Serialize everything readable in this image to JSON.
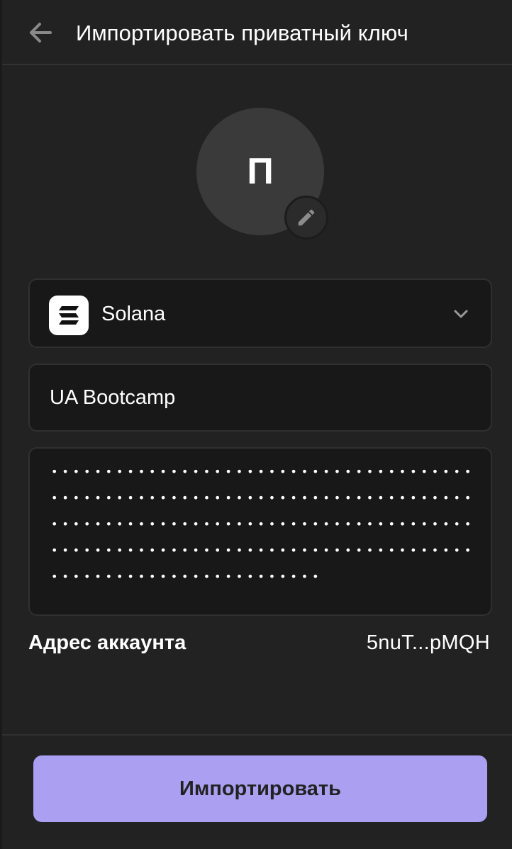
{
  "header": {
    "title": "Импортировать приватный ключ",
    "back_icon": "arrow-left-icon"
  },
  "avatar": {
    "letter": "П",
    "edit_icon": "pencil-icon"
  },
  "network": {
    "name": "Solana",
    "logo_icon": "solana-logo-icon",
    "chevron_icon": "chevron-down-icon"
  },
  "account_name": {
    "value": "UA Bootcamp"
  },
  "private_key": {
    "masked_value": "•••••••••••••••••••••••••••••••••••••••••••••••••••••••••••••••••••••••••••••••••••••••••••••••••••••••••••••••••••••••••••••••••••••••••••••••••••••••••••••••••••••••••••••••••••••"
  },
  "address": {
    "label": "Адрес аккаунта",
    "value": "5nuT...pMQH"
  },
  "import_button": {
    "label": "Импортировать"
  },
  "colors": {
    "background": "#222222",
    "field_background": "#181818",
    "accent": "#ab9ff2"
  }
}
